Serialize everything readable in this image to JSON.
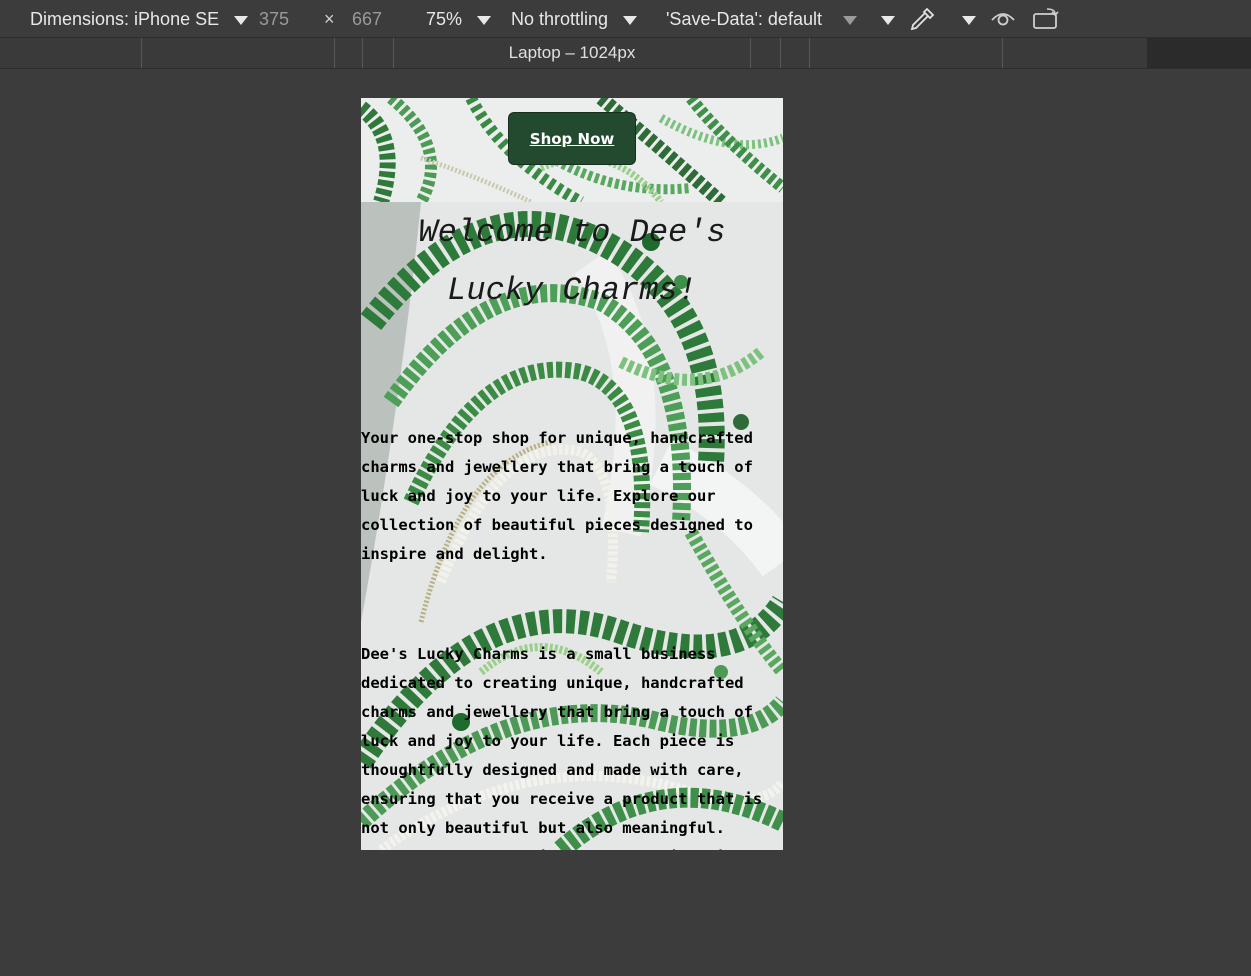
{
  "devtools": {
    "device_label": "Dimensions: iPhone SE",
    "width": "375",
    "times": "×",
    "height": "667",
    "zoom": "75%",
    "throttling": "No throttling",
    "save_data": "'Save-Data': default",
    "media_query_label": "Laptop – 1024px",
    "icons": [
      "chevron-down-icon",
      "eyedropper-icon",
      "eye-icon",
      "rotate-icon"
    ]
  },
  "page": {
    "hero_button": "Shop Now",
    "title_line1": "Welcome to Dee's",
    "title_line2": "Lucky Charms!",
    "intro": "Your one-stop shop for unique, handcrafted charms and jewellery that bring a touch of luck and joy to your life. Explore our collection of beautiful pieces designed to inspire and delight.",
    "about": "Dee's Lucky Charms is a small business dedicated to creating unique, handcrafted charms and jewellery that bring a touch of luck and joy to your life. Each piece is thoughtfully designed and made with care, ensuring that you receive a product that is not only beautiful but also meaningful. Whether you're looking for a special gift or a personal talisman, Dee's Lucky Charms has something for everyone. Explore our collection and find the perfect charm to"
  },
  "colors": {
    "devtools_bg": "#3c3c3c",
    "button_bg": "#234a2f",
    "bead_green": "#3f8f4a"
  }
}
